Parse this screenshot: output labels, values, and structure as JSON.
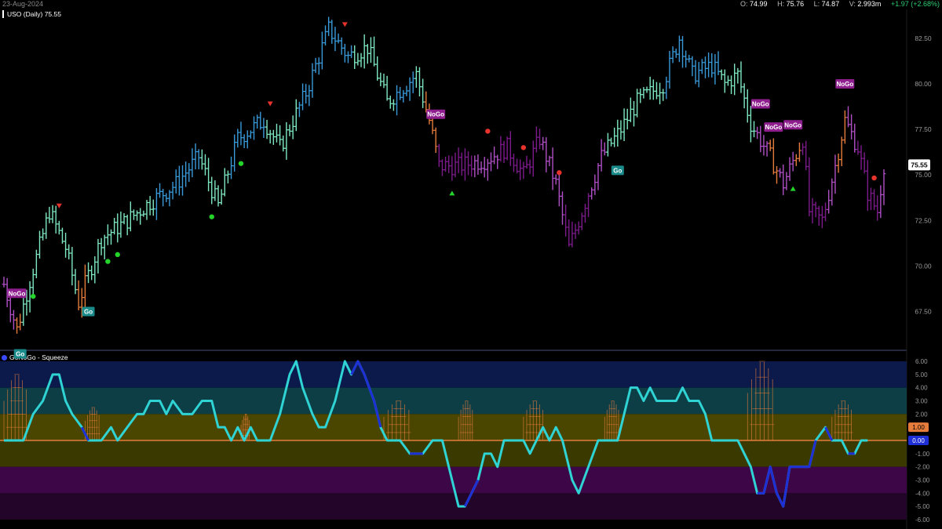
{
  "header": {
    "date": "23-Aug-2024",
    "open_label": "O:",
    "open": "74.99",
    "high_label": "H:",
    "high": "75.76",
    "low_label": "L:",
    "low": "74.87",
    "volume_label": "V:",
    "volume": "2.993m",
    "change": "+1.97 (+2.68%)"
  },
  "price_panel": {
    "title": "USO (Daily) 75.55",
    "last_price_label": "75.55"
  },
  "indicator_panel": {
    "title": "GoNoGo - Squeeze",
    "squeeze_label": "1.00",
    "zero_label": "0.00"
  },
  "colors": {
    "background": "#000000",
    "strong_go": "#3a9ad9",
    "go": "#7ee8c2",
    "nogo": "#b04fc6",
    "strong_nogo": "#7d1a8c",
    "amber": "#e57c3c",
    "oscillator": "#2fd3d3",
    "oscillator_max": "#1f2fd6",
    "squeeze_grid": "#e57c3c"
  },
  "chart_data": [
    {
      "type": "ohlc",
      "title": "USO (Daily) 75.55",
      "ylim": [
        65.5,
        84.0
      ],
      "y_ticks": [
        67.5,
        70.0,
        72.5,
        75.0,
        77.5,
        80.0,
        82.5
      ],
      "y_tick_labels": [
        "67.50",
        "70.00",
        "72.50",
        "75.00",
        "77.50",
        "80.00",
        "82.50"
      ],
      "last_price": 75.55,
      "trend_segments": [
        {
          "from": 0,
          "to": 3,
          "state": "nogo"
        },
        {
          "from": 4,
          "to": 5,
          "state": "amber"
        },
        {
          "from": 6,
          "to": 22,
          "state": "go"
        },
        {
          "from": 23,
          "to": 25,
          "state": "amber"
        },
        {
          "from": 26,
          "to": 46,
          "state": "go"
        },
        {
          "from": 47,
          "to": 60,
          "state": "strong_go"
        },
        {
          "from": 61,
          "to": 69,
          "state": "go"
        },
        {
          "from": 70,
          "to": 80,
          "state": "strong_go"
        },
        {
          "from": 81,
          "to": 90,
          "state": "go"
        },
        {
          "from": 91,
          "to": 107,
          "state": "strong_go"
        },
        {
          "from": 108,
          "to": 120,
          "state": "go"
        },
        {
          "from": 121,
          "to": 126,
          "state": "strong_go"
        },
        {
          "from": 127,
          "to": 129,
          "state": "go"
        },
        {
          "from": 130,
          "to": 133,
          "state": "amber"
        },
        {
          "from": 134,
          "to": 144,
          "state": "strong_nogo"
        },
        {
          "from": 145,
          "to": 152,
          "state": "nogo"
        },
        {
          "from": 153,
          "to": 165,
          "state": "strong_nogo"
        },
        {
          "from": 166,
          "to": 172,
          "state": "nogo"
        },
        {
          "from": 173,
          "to": 180,
          "state": "strong_nogo"
        },
        {
          "from": 181,
          "to": 185,
          "state": "nogo"
        },
        {
          "from": 186,
          "to": 190,
          "state": "go"
        },
        {
          "from": 191,
          "to": 203,
          "state": "go"
        },
        {
          "from": 204,
          "to": 220,
          "state": "strong_go"
        },
        {
          "from": 221,
          "to": 231,
          "state": "go"
        },
        {
          "from": 232,
          "to": 235,
          "state": "nogo"
        },
        {
          "from": 236,
          "to": 238,
          "state": "amber"
        },
        {
          "from": 239,
          "to": 243,
          "state": "nogo"
        },
        {
          "from": 244,
          "to": 245,
          "state": "amber"
        },
        {
          "from": 246,
          "to": 253,
          "state": "strong_nogo"
        },
        {
          "from": 254,
          "to": 256,
          "state": "nogo"
        },
        {
          "from": 257,
          "to": 259,
          "state": "amber"
        },
        {
          "from": 260,
          "to": 262,
          "state": "nogo"
        },
        {
          "from": 263,
          "to": 269,
          "state": "strong_nogo"
        },
        {
          "from": 270,
          "to": 271,
          "state": "nogo"
        }
      ],
      "price_path": [
        [
          0,
          69.0
        ],
        [
          4,
          66.5
        ],
        [
          8,
          69.2
        ],
        [
          14,
          73.0
        ],
        [
          19,
          71.0
        ],
        [
          23,
          68.0
        ],
        [
          30,
          71.5
        ],
        [
          38,
          72.5
        ],
        [
          45,
          73.5
        ],
        [
          53,
          74.5
        ],
        [
          60,
          76.0
        ],
        [
          66,
          73.3
        ],
        [
          72,
          77.0
        ],
        [
          80,
          78.0
        ],
        [
          85,
          76.5
        ],
        [
          93,
          79.5
        ],
        [
          100,
          83.0
        ],
        [
          106,
          81.5
        ],
        [
          112,
          82.0
        ],
        [
          118,
          79.0
        ],
        [
          124,
          80.0
        ],
        [
          127,
          80.5
        ],
        [
          131,
          78.0
        ],
        [
          134,
          75.5
        ],
        [
          140,
          75.5
        ],
        [
          148,
          75.8
        ],
        [
          155,
          76.5
        ],
        [
          160,
          75.0
        ],
        [
          165,
          77.0
        ],
        [
          170,
          74.5
        ],
        [
          174,
          71.0
        ],
        [
          178,
          73.0
        ],
        [
          184,
          76.0
        ],
        [
          190,
          77.5
        ],
        [
          195,
          79.0
        ],
        [
          203,
          80.0
        ],
        [
          208,
          82.5
        ],
        [
          212,
          80.5
        ],
        [
          218,
          81.0
        ],
        [
          222,
          80.0
        ],
        [
          226,
          80.5
        ],
        [
          230,
          77.8
        ],
        [
          236,
          76.0
        ],
        [
          240,
          74.5
        ],
        [
          246,
          77.0
        ],
        [
          248,
          73.0
        ],
        [
          252,
          72.5
        ],
        [
          256,
          75.5
        ],
        [
          259,
          78.0
        ],
        [
          263,
          76.5
        ],
        [
          266,
          74.0
        ],
        [
          269,
          73.0
        ],
        [
          271,
          75.55
        ]
      ],
      "annotations": [
        {
          "label": "NoGo",
          "x": 4,
          "state": "nogo"
        },
        {
          "label": "Go",
          "x": 5,
          "state": "go"
        },
        {
          "label": "Go",
          "x": 26,
          "state": "go"
        },
        {
          "label": "NoGo",
          "x": 133,
          "state": "nogo"
        },
        {
          "label": "Go",
          "x": 189,
          "state": "go"
        },
        {
          "label": "NoGo",
          "x": 233,
          "state": "nogo"
        },
        {
          "label": "NoGo",
          "x": 237,
          "state": "nogo"
        },
        {
          "label": "NoGo",
          "x": 243,
          "state": "nogo"
        },
        {
          "label": "NoGo",
          "x": 259,
          "state": "nogo"
        }
      ],
      "markers": [
        {
          "kind": "dot",
          "color": "green",
          "x": 9,
          "at": "below"
        },
        {
          "kind": "tri_down",
          "color": "red",
          "x": 17,
          "at": "above"
        },
        {
          "kind": "dot",
          "color": "green",
          "x": 32,
          "at": "below"
        },
        {
          "kind": "dot",
          "color": "green",
          "x": 35,
          "at": "below"
        },
        {
          "kind": "dot",
          "color": "green",
          "x": 64,
          "at": "below"
        },
        {
          "kind": "dot",
          "color": "green",
          "x": 73,
          "at": "below"
        },
        {
          "kind": "tri_down",
          "color": "red",
          "x": 82,
          "at": "above"
        },
        {
          "kind": "tri_down",
          "color": "red",
          "x": 105,
          "at": "above"
        },
        {
          "kind": "tri_up",
          "color": "green",
          "x": 138,
          "at": "below"
        },
        {
          "kind": "dot",
          "color": "red",
          "x": 149,
          "at": "above"
        },
        {
          "kind": "dot",
          "color": "red",
          "x": 160,
          "at": "above"
        },
        {
          "kind": "dot",
          "color": "red",
          "x": 171,
          "at": "above"
        },
        {
          "kind": "tri_up",
          "color": "green",
          "x": 243,
          "at": "below"
        },
        {
          "kind": "dot",
          "color": "red",
          "x": 268,
          "at": "above"
        }
      ]
    },
    {
      "type": "line",
      "title": "GoNoGo - Squeeze",
      "ylim": [
        -6.0,
        6.0
      ],
      "y_ticks": [
        -6,
        -5,
        -4,
        -3,
        -2,
        -1,
        0,
        1,
        2,
        3,
        4,
        5,
        6
      ],
      "y_tick_labels": [
        "-6.00",
        "-5.00",
        "-4.00",
        "-3.00",
        "-2.00",
        "-1.00",
        "0.00",
        "1.00",
        "2.00",
        "3.00",
        "4.00",
        "5.00",
        "6.00"
      ],
      "bands": [
        {
          "from": 4,
          "to": 6,
          "color": "#0b1a4a"
        },
        {
          "from": 2,
          "to": 4,
          "color": "#0d3d45"
        },
        {
          "from": 0,
          "to": 2,
          "color": "#4a4600"
        },
        {
          "from": -2,
          "to": 0,
          "color": "#3a3a00"
        },
        {
          "from": -4,
          "to": -2,
          "color": "#3d0747"
        },
        {
          "from": -6,
          "to": -4,
          "color": "#230529"
        }
      ],
      "oscillator": [
        [
          0,
          0
        ],
        [
          6,
          0
        ],
        [
          9,
          2
        ],
        [
          12,
          3
        ],
        [
          15,
          5
        ],
        [
          17,
          5
        ],
        [
          19,
          3
        ],
        [
          21,
          2
        ],
        [
          24,
          1
        ],
        [
          26,
          0
        ],
        [
          30,
          0
        ],
        [
          33,
          1
        ],
        [
          35,
          0
        ],
        [
          38,
          1
        ],
        [
          41,
          2
        ],
        [
          43,
          2
        ],
        [
          45,
          3
        ],
        [
          48,
          3
        ],
        [
          50,
          2
        ],
        [
          52,
          3
        ],
        [
          55,
          2
        ],
        [
          58,
          2
        ],
        [
          61,
          3
        ],
        [
          64,
          3
        ],
        [
          66,
          1
        ],
        [
          68,
          1
        ],
        [
          70,
          0
        ],
        [
          72,
          1
        ],
        [
          74,
          0
        ],
        [
          76,
          1
        ],
        [
          78,
          0
        ],
        [
          82,
          0
        ],
        [
          85,
          2
        ],
        [
          88,
          5
        ],
        [
          90,
          6
        ],
        [
          92,
          4
        ],
        [
          95,
          2
        ],
        [
          97,
          1
        ],
        [
          99,
          1
        ],
        [
          102,
          3
        ],
        [
          105,
          6
        ],
        [
          107,
          5
        ],
        [
          109,
          6
        ],
        [
          111,
          5
        ],
        [
          114,
          3
        ],
        [
          116,
          1
        ],
        [
          118,
          0
        ],
        [
          122,
          0
        ],
        [
          125,
          -1
        ],
        [
          129,
          -1
        ],
        [
          132,
          0
        ],
        [
          135,
          0
        ],
        [
          138,
          -3
        ],
        [
          140,
          -5
        ],
        [
          142,
          -5
        ],
        [
          144,
          -4
        ],
        [
          146,
          -3
        ],
        [
          148,
          -1
        ],
        [
          150,
          -1
        ],
        [
          152,
          -2
        ],
        [
          154,
          0
        ],
        [
          157,
          0
        ],
        [
          160,
          0
        ],
        [
          162,
          -1
        ],
        [
          164,
          0
        ],
        [
          166,
          1
        ],
        [
          168,
          0
        ],
        [
          170,
          1
        ],
        [
          172,
          0
        ],
        [
          175,
          -3
        ],
        [
          177,
          -4
        ],
        [
          180,
          -2
        ],
        [
          183,
          0
        ],
        [
          186,
          0
        ],
        [
          189,
          0
        ],
        [
          191,
          2
        ],
        [
          193,
          4
        ],
        [
          195,
          4
        ],
        [
          197,
          3
        ],
        [
          199,
          4
        ],
        [
          201,
          3
        ],
        [
          204,
          3
        ],
        [
          207,
          3
        ],
        [
          209,
          4
        ],
        [
          211,
          3
        ],
        [
          214,
          3
        ],
        [
          216,
          2
        ],
        [
          218,
          0
        ],
        [
          222,
          0
        ],
        [
          226,
          0
        ],
        [
          228,
          -1
        ],
        [
          230,
          -2
        ],
        [
          232,
          -4
        ],
        [
          234,
          -4
        ],
        [
          236,
          -2
        ],
        [
          238,
          -4
        ],
        [
          240,
          -5
        ],
        [
          242,
          -2
        ],
        [
          244,
          -2
        ],
        [
          248,
          -2
        ],
        [
          250,
          0
        ],
        [
          253,
          1
        ],
        [
          255,
          0
        ],
        [
          258,
          0
        ],
        [
          260,
          -1
        ],
        [
          262,
          -1
        ],
        [
          264,
          0
        ],
        [
          266,
          0
        ]
      ],
      "max_segments": [
        [
          24,
          27
        ],
        [
          107,
          117
        ],
        [
          124,
          130
        ],
        [
          142,
          146
        ],
        [
          231,
          250
        ],
        [
          253,
          255
        ],
        [
          260,
          263
        ]
      ],
      "squeeze_zones": [
        {
          "from": 0,
          "to": 8,
          "height": 5
        },
        {
          "from": 25,
          "to": 30,
          "height": 2.5
        },
        {
          "from": 73,
          "to": 76,
          "height": 2.0
        },
        {
          "from": 117,
          "to": 126,
          "height": 3.0
        },
        {
          "from": 140,
          "to": 145,
          "height": 3.0
        },
        {
          "from": 160,
          "to": 167,
          "height": 3.0
        },
        {
          "from": 185,
          "to": 190,
          "height": 3.0
        },
        {
          "from": 229,
          "to": 238,
          "height": 6.0
        },
        {
          "from": 255,
          "to": 262,
          "height": 3.0
        }
      ]
    }
  ]
}
